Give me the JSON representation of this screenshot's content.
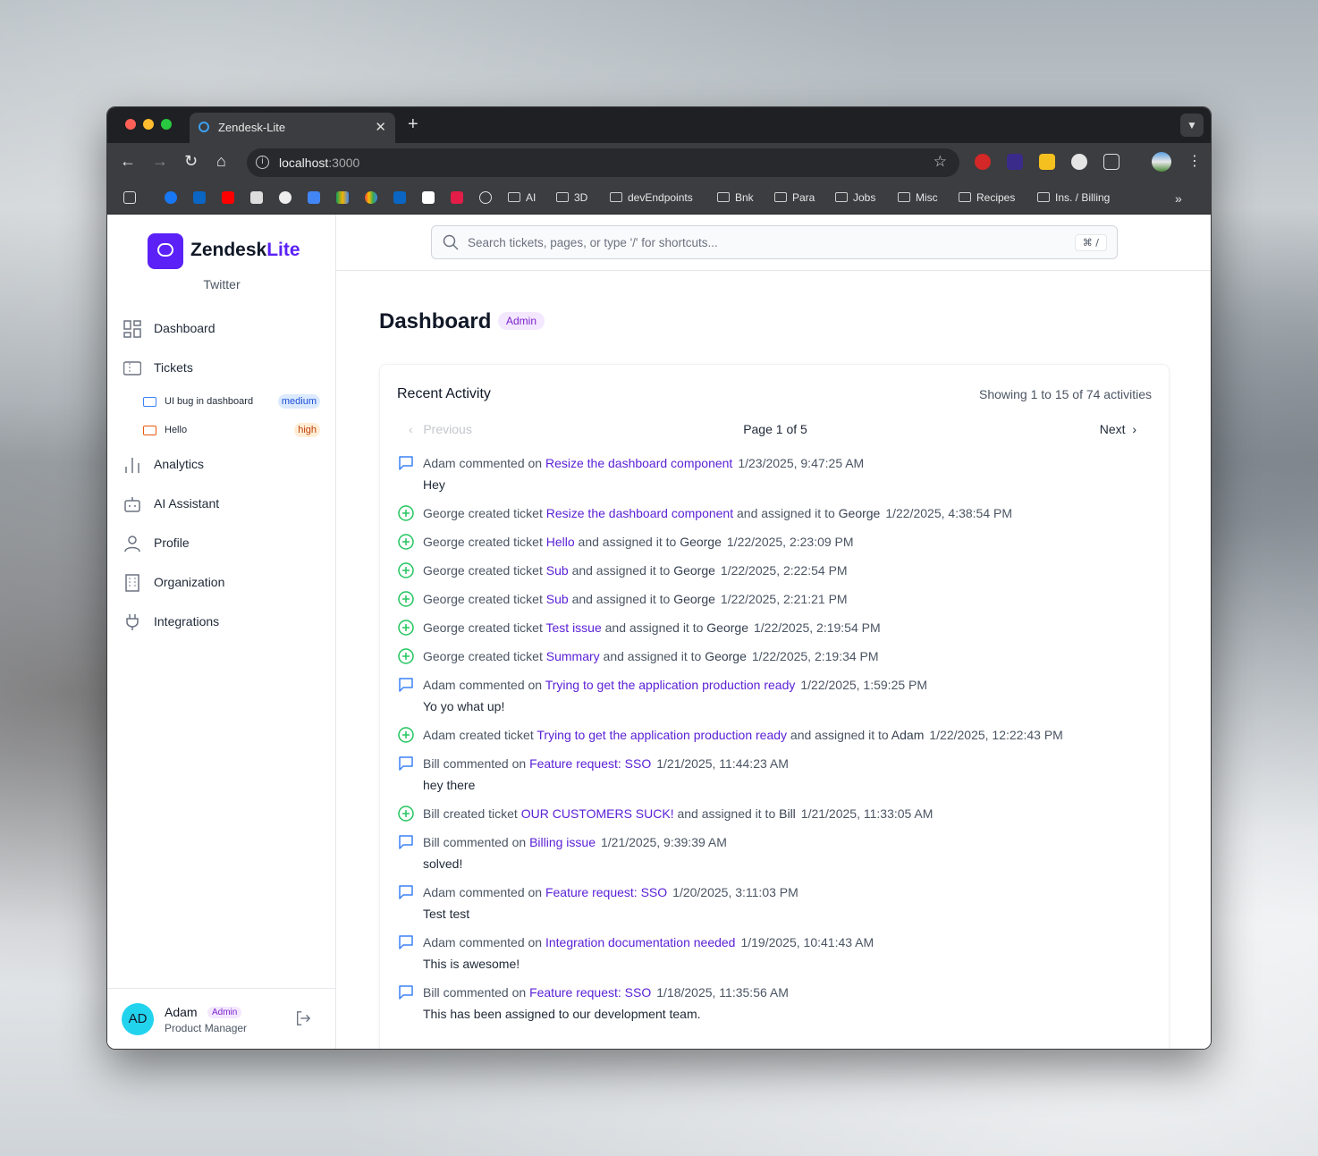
{
  "browser": {
    "tab_title": "Zendesk-Lite",
    "url_host": "localhost",
    "url_port": ":3000",
    "bookmarks": [
      "AI",
      "3D",
      "devEndpoints",
      "Bnk",
      "Para",
      "Jobs",
      "Misc",
      "Recipes",
      "Ins. / Billing"
    ]
  },
  "sidebar": {
    "logo_main": "Zendesk",
    "logo_accent": "Lite",
    "org": "Twitter",
    "nav": [
      {
        "label": "Dashboard",
        "icon": "dashboard-grid-icon"
      },
      {
        "label": "Tickets",
        "icon": "ticket-icon"
      },
      {
        "label": "Analytics",
        "icon": "bar-chart-icon"
      },
      {
        "label": "AI Assistant",
        "icon": "robot-icon"
      },
      {
        "label": "Profile",
        "icon": "user-icon"
      },
      {
        "label": "Organization",
        "icon": "building-icon"
      },
      {
        "label": "Integrations",
        "icon": "plug-icon"
      }
    ],
    "recent_tickets": [
      {
        "label": "UI bug in dashboard",
        "priority": "medium"
      },
      {
        "label": "Hello",
        "priority": "high"
      }
    ],
    "user": {
      "initials": "AD",
      "name": "Adam",
      "role": "Admin",
      "title": "Product Manager"
    }
  },
  "search": {
    "placeholder": "Search tickets, pages, or type '/' for shortcuts...",
    "shortcut": "⌘ /"
  },
  "page": {
    "title": "Dashboard",
    "badge": "Admin"
  },
  "activity": {
    "title": "Recent Activity",
    "showing": "Showing 1 to 15 of 74 activities",
    "prev": "Previous",
    "page_info": "Page 1 of 5",
    "next": "Next",
    "items": [
      {
        "type": "comment",
        "actor": "Adam",
        "verb": "commented on",
        "ticket": "Resize the dashboard component",
        "assignee": "",
        "time": "1/23/2025, 9:47:25 AM",
        "body": "Hey"
      },
      {
        "type": "create",
        "actor": "George",
        "verb": "created ticket",
        "ticket": "Resize the dashboard component",
        "assignee": "George",
        "time": "1/22/2025, 4:38:54 PM",
        "body": ""
      },
      {
        "type": "create",
        "actor": "George",
        "verb": "created ticket",
        "ticket": "Hello",
        "assignee": "George",
        "time": "1/22/2025, 2:23:09 PM",
        "body": ""
      },
      {
        "type": "create",
        "actor": "George",
        "verb": "created ticket",
        "ticket": "Sub",
        "assignee": "George",
        "time": "1/22/2025, 2:22:54 PM",
        "body": ""
      },
      {
        "type": "create",
        "actor": "George",
        "verb": "created ticket",
        "ticket": "Sub",
        "assignee": "George",
        "time": "1/22/2025, 2:21:21 PM",
        "body": ""
      },
      {
        "type": "create",
        "actor": "George",
        "verb": "created ticket",
        "ticket": "Test issue",
        "assignee": "George",
        "time": "1/22/2025, 2:19:54 PM",
        "body": ""
      },
      {
        "type": "create",
        "actor": "George",
        "verb": "created ticket",
        "ticket": "Summary",
        "assignee": "George",
        "time": "1/22/2025, 2:19:34 PM",
        "body": ""
      },
      {
        "type": "comment",
        "actor": "Adam",
        "verb": "commented on",
        "ticket": "Trying to get the application production ready",
        "assignee": "",
        "time": "1/22/2025, 1:59:25 PM",
        "body": "Yo yo what up!"
      },
      {
        "type": "create",
        "actor": "Adam",
        "verb": "created ticket",
        "ticket": "Trying to get the application production ready",
        "assignee": "Adam",
        "time": "1/22/2025, 12:22:43 PM",
        "body": ""
      },
      {
        "type": "comment",
        "actor": "Bill",
        "verb": "commented on",
        "ticket": "Feature request: SSO",
        "assignee": "",
        "time": "1/21/2025, 11:44:23 AM",
        "body": "hey there"
      },
      {
        "type": "create",
        "actor": "Bill",
        "verb": "created ticket",
        "ticket": "OUR CUSTOMERS SUCK!",
        "assignee": "Bill",
        "time": "1/21/2025, 11:33:05 AM",
        "body": ""
      },
      {
        "type": "comment",
        "actor": "Bill",
        "verb": "commented on",
        "ticket": "Billing issue",
        "assignee": "",
        "time": "1/21/2025, 9:39:39 AM",
        "body": "solved!"
      },
      {
        "type": "comment",
        "actor": "Adam",
        "verb": "commented on",
        "ticket": "Feature request: SSO",
        "assignee": "",
        "time": "1/20/2025, 3:11:03 PM",
        "body": "Test test"
      },
      {
        "type": "comment",
        "actor": "Adam",
        "verb": "commented on",
        "ticket": "Integration documentation needed",
        "assignee": "",
        "time": "1/19/2025, 10:41:43 AM",
        "body": "This is awesome!"
      },
      {
        "type": "comment",
        "actor": "Bill",
        "verb": "commented on",
        "ticket": "Feature request: SSO",
        "assignee": "",
        "time": "1/18/2025, 11:35:56 AM",
        "body": "This has been assigned to our development team."
      }
    ],
    "assigned_phrase": "and assigned it to"
  }
}
